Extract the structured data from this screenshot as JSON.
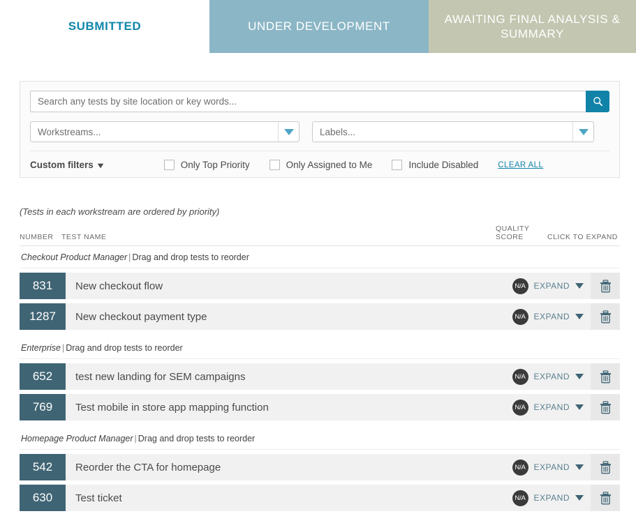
{
  "tabs": [
    {
      "label": "SUBMITTED",
      "state": "inactive-light",
      "color": "#1186ab"
    },
    {
      "label": "UNDER DEVELOPMENT",
      "state": "active",
      "color": "#8bb6c6"
    },
    {
      "label": "AWAITING FINAL ANALYSIS & SUMMARY",
      "state": "inactive-olive",
      "color": "#c3c6b0"
    }
  ],
  "search": {
    "placeholder": "Search any tests by site location or key words...",
    "value": "",
    "button_icon": "search-icon",
    "button_color": "#1283a8"
  },
  "filters": {
    "workstreams_placeholder": "Workstreams...",
    "labels_placeholder": "Labels...",
    "custom_filters_label": "Custom filters",
    "custom_filters_icon": "chevron-down-icon",
    "checkboxes": [
      {
        "label": "Only Top Priority",
        "checked": false
      },
      {
        "label": "Only Assigned to Me",
        "checked": false
      },
      {
        "label": "Include Disabled",
        "checked": false
      }
    ],
    "clear_all_label": "CLEAR ALL"
  },
  "list": {
    "hint": "(Tests in each workstream are ordered by priority)",
    "columns": {
      "number": "NUMBER",
      "test_name": "TEST NAME",
      "quality_score": "QUALITY SCORE",
      "click_to_expand": "CLICK TO EXPAND"
    },
    "reorder_hint": "Drag and drop tests to reorder",
    "separator": "|",
    "expand_label": "EXPAND",
    "groups": [
      {
        "workstream": "Checkout Product Manager",
        "rows": [
          {
            "number": "831",
            "name": "New checkout flow",
            "quality_score": "N/A"
          },
          {
            "number": "1287",
            "name": "New checkout payment type",
            "quality_score": "N/A"
          }
        ]
      },
      {
        "workstream": "Enterprise",
        "rows": [
          {
            "number": "652",
            "name": "test new landing for SEM campaigns",
            "quality_score": "N/A"
          },
          {
            "number": "769",
            "name": "Test mobile in store app mapping function",
            "quality_score": "N/A"
          }
        ]
      },
      {
        "workstream": "Homepage Product Manager",
        "rows": [
          {
            "number": "542",
            "name": "Reorder the CTA for homepage",
            "quality_score": "N/A"
          },
          {
            "number": "630",
            "name": "Test ticket",
            "quality_score": "N/A"
          }
        ]
      }
    ]
  }
}
